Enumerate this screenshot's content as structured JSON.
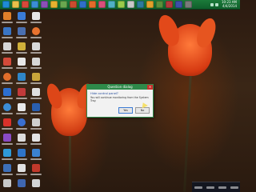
{
  "taskbar": {
    "clock_time": "10:23 AM",
    "clock_date": "4/4/2014"
  },
  "dialog": {
    "title": "Question dialog",
    "message_main": "Hide control panel?",
    "message_sub": "You will continue monitoring from the System Tray.",
    "yes_label": "Yes",
    "no_label": "No"
  }
}
